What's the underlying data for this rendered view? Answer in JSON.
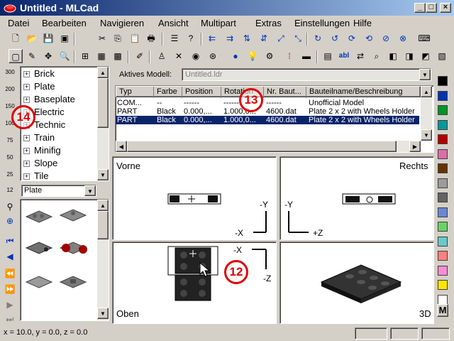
{
  "window": {
    "title": "Untitled - MLCad"
  },
  "menu": [
    "Datei",
    "Bearbeiten",
    "Navigieren",
    "Ansicht",
    "Multipart",
    "Extras",
    "Einstellungen",
    "Hilfe"
  ],
  "toolbar1_icons": [
    "new",
    "open",
    "save",
    "save-all",
    "cut",
    "copy",
    "paste",
    "print",
    "properties",
    "help-pointer",
    "move-left",
    "move-right",
    "move-up",
    "move-down",
    "move-front",
    "move-back",
    "rotate-x-pos",
    "rotate-x-neg",
    "rotate-y-pos",
    "rotate-y-neg",
    "rotate-z-pos",
    "rotate-z-neg",
    "keyboard"
  ],
  "toolbar2_icons": [
    "select",
    "edit",
    "move",
    "zoom",
    "grid-coarse",
    "grid-medium",
    "grid-fine",
    "pen",
    "minifig",
    "delete",
    "step",
    "ghost",
    "light",
    "bulb",
    "hose",
    "grid-dots",
    "camera",
    "model-info",
    "label-abl",
    "model-xchg",
    "search",
    "model-a",
    "model-b",
    "model-c"
  ],
  "left_tools": [
    "300",
    "200",
    "150",
    "100",
    "75",
    "50",
    "25",
    "12"
  ],
  "tree": {
    "items": [
      "Brick",
      "Plate",
      "Baseplate",
      "Electric",
      "Technic",
      "Train",
      "Minifig",
      "Slope",
      "Tile"
    ]
  },
  "category_select": {
    "value": "Plate"
  },
  "model": {
    "label": "Aktives Modell:",
    "value": "Untitled.ldr"
  },
  "table": {
    "headers": [
      "Typ",
      "Farbe",
      "Position",
      "Rotation",
      "Nr. Baut...",
      "Bauteilname/Beschreibung"
    ],
    "rows": [
      [
        "COM...",
        "--",
        "------",
        "------",
        "------",
        "Unofficial Model"
      ],
      [
        "PART",
        "Black",
        "0.000,...",
        "1.000,0...",
        "4600.dat",
        "Plate  2 x  2 with Wheels Holder"
      ],
      [
        "PART",
        "Black",
        "0.000,...",
        "1.000,0...",
        "4600.dat",
        "Plate  2 x  2 with Wheels Holder"
      ]
    ]
  },
  "views": {
    "front": "Vorne",
    "right": "Rechts",
    "top": "Oben",
    "persp": "3D"
  },
  "axes": {
    "neg_y": "-Y",
    "neg_x": "-X",
    "pos_z": "+Z",
    "neg_z": "-Z"
  },
  "badges": {
    "b12": "12",
    "b13": "13",
    "b14": "14"
  },
  "colors": [
    "#000000",
    "#0033b2",
    "#00952b",
    "#009999",
    "#b20000",
    "#dc6ea5",
    "#663300",
    "#9c9c9c",
    "#636363",
    "#6a87d2",
    "#6ad267",
    "#6ac9c9",
    "#ff8080",
    "#f78cd6",
    "#ffe600",
    "#ffffff"
  ],
  "palette_label": "M",
  "status": {
    "coords": "x = 10.0, y = 0.0, z = 0.0"
  }
}
